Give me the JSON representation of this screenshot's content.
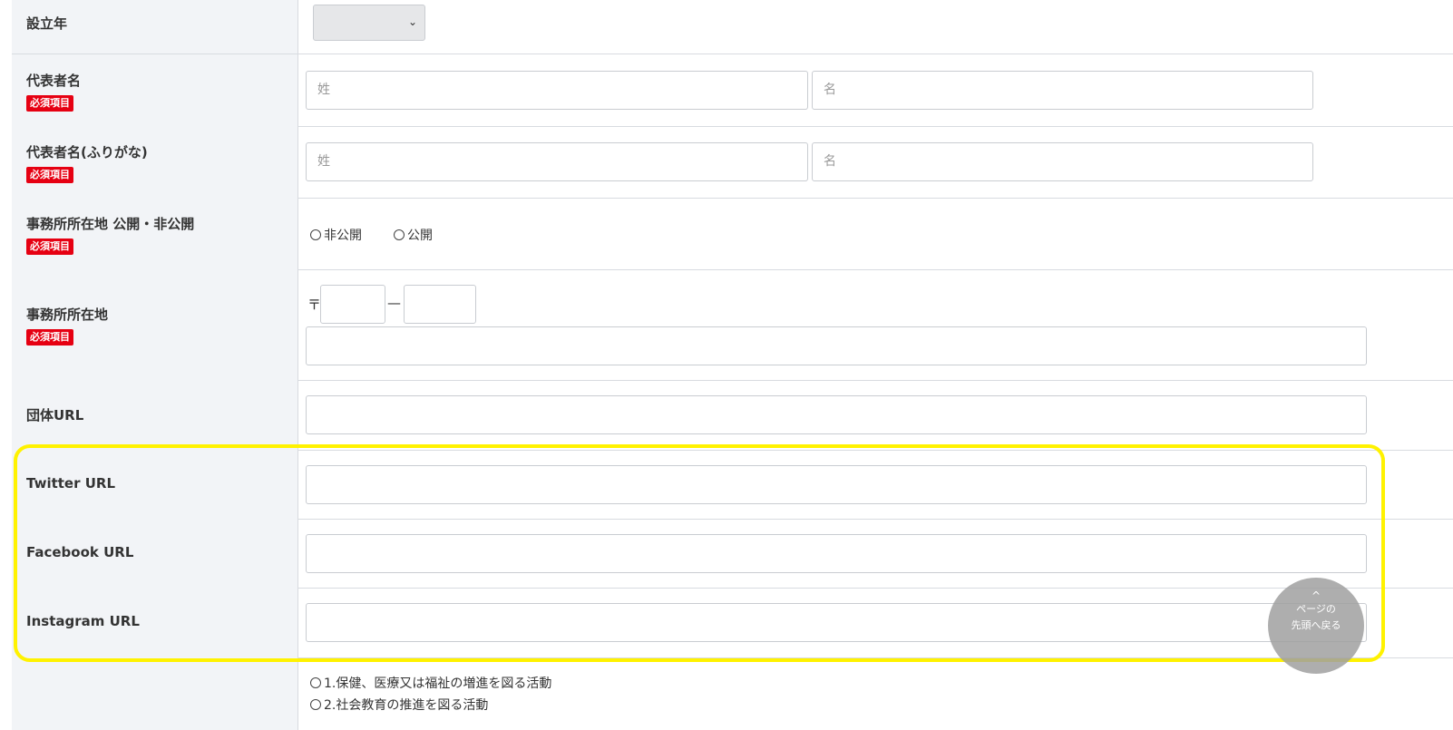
{
  "rows": {
    "established_year": {
      "label": "設立年"
    },
    "rep_name": {
      "label": "代表者名",
      "required": "必須項目",
      "last_placeholder": "姓",
      "first_placeholder": "名"
    },
    "rep_kana": {
      "label": "代表者名(ふりがな)",
      "required": "必須項目",
      "last_placeholder": "姓",
      "first_placeholder": "名"
    },
    "office_visibility": {
      "label": "事務所所在地 公開・非公開",
      "required": "必須項目",
      "options": [
        "非公開",
        "公開"
      ]
    },
    "office_address": {
      "label": "事務所所在地",
      "required": "必須項目",
      "postal_mark": "〒",
      "dash": "—"
    },
    "org_url": {
      "label": "団体URL"
    },
    "twitter_url": {
      "label": "Twitter URL"
    },
    "facebook_url": {
      "label": "Facebook URL"
    },
    "instagram_url": {
      "label": "Instagram URL"
    },
    "activities": {
      "options": [
        "1.保健、医療又は福祉の増進を図る活動",
        "2.社会教育の推進を図る活動"
      ]
    }
  },
  "back_to_top": {
    "caret": "^",
    "line1": "ページの",
    "line2": "先頭へ戻る"
  },
  "colors": {
    "required_badge": "#e60012",
    "highlight": "#fff200",
    "label_bg": "#f2f4f7"
  }
}
